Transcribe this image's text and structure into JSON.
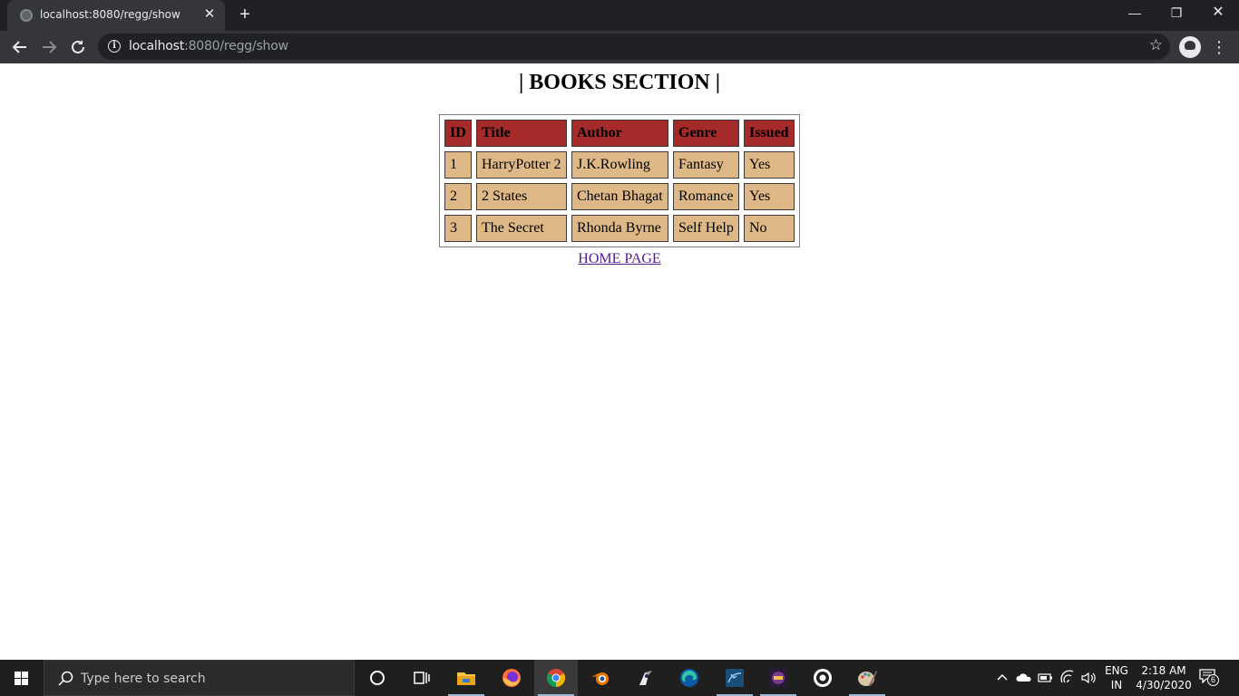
{
  "browser": {
    "tab_title": "localhost:8080/regg/show",
    "url_host": "localhost",
    "url_path": ":8080/regg/show"
  },
  "page": {
    "title": "| BOOKS SECTION |",
    "table": {
      "headers": [
        "ID",
        "Title",
        "Author",
        "Genre",
        "Issued"
      ],
      "rows": [
        [
          "1",
          "HarryPotter 2",
          "J.K.Rowling",
          "Fantasy",
          "Yes"
        ],
        [
          "2",
          "2 States",
          "Chetan Bhagat",
          "Romance",
          "Yes"
        ],
        [
          "3",
          "The Secret",
          "Rhonda Byrne",
          "Self Help",
          "No"
        ]
      ]
    },
    "home_link": "HOME PAGE"
  },
  "taskbar": {
    "search_placeholder": "Type here to search",
    "apps": [
      "cortana-icon",
      "task-view-icon",
      "file-explorer-icon",
      "firefox-icon",
      "chrome-icon",
      "blender-icon",
      "eclipse-icon",
      "edge-icon",
      "mysql-workbench-icon",
      "ageia-icon",
      "obs-icon",
      "paint-icon"
    ],
    "lang_line1": "ENG",
    "lang_line2": "IN",
    "time": "2:18 AM",
    "date": "4/30/2020",
    "notification_count": "6"
  },
  "colors": {
    "header_cell": "#a52a2a",
    "body_cell": "#deb887",
    "link_visited": "#551a8b"
  }
}
